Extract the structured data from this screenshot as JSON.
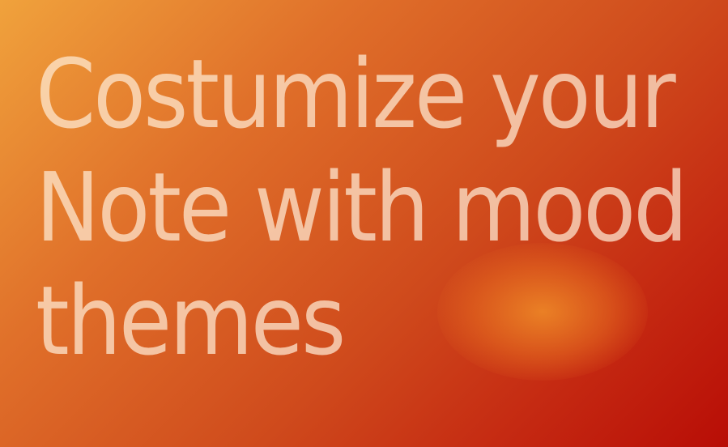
{
  "headline": {
    "lines": [
      "Costumize your",
      "Note with mood",
      "themes"
    ]
  },
  "colors": {
    "gradient_start": "#f0a23c",
    "gradient_end": "#b80d06",
    "glow": "#ec8426",
    "text": "#ffecd6"
  }
}
